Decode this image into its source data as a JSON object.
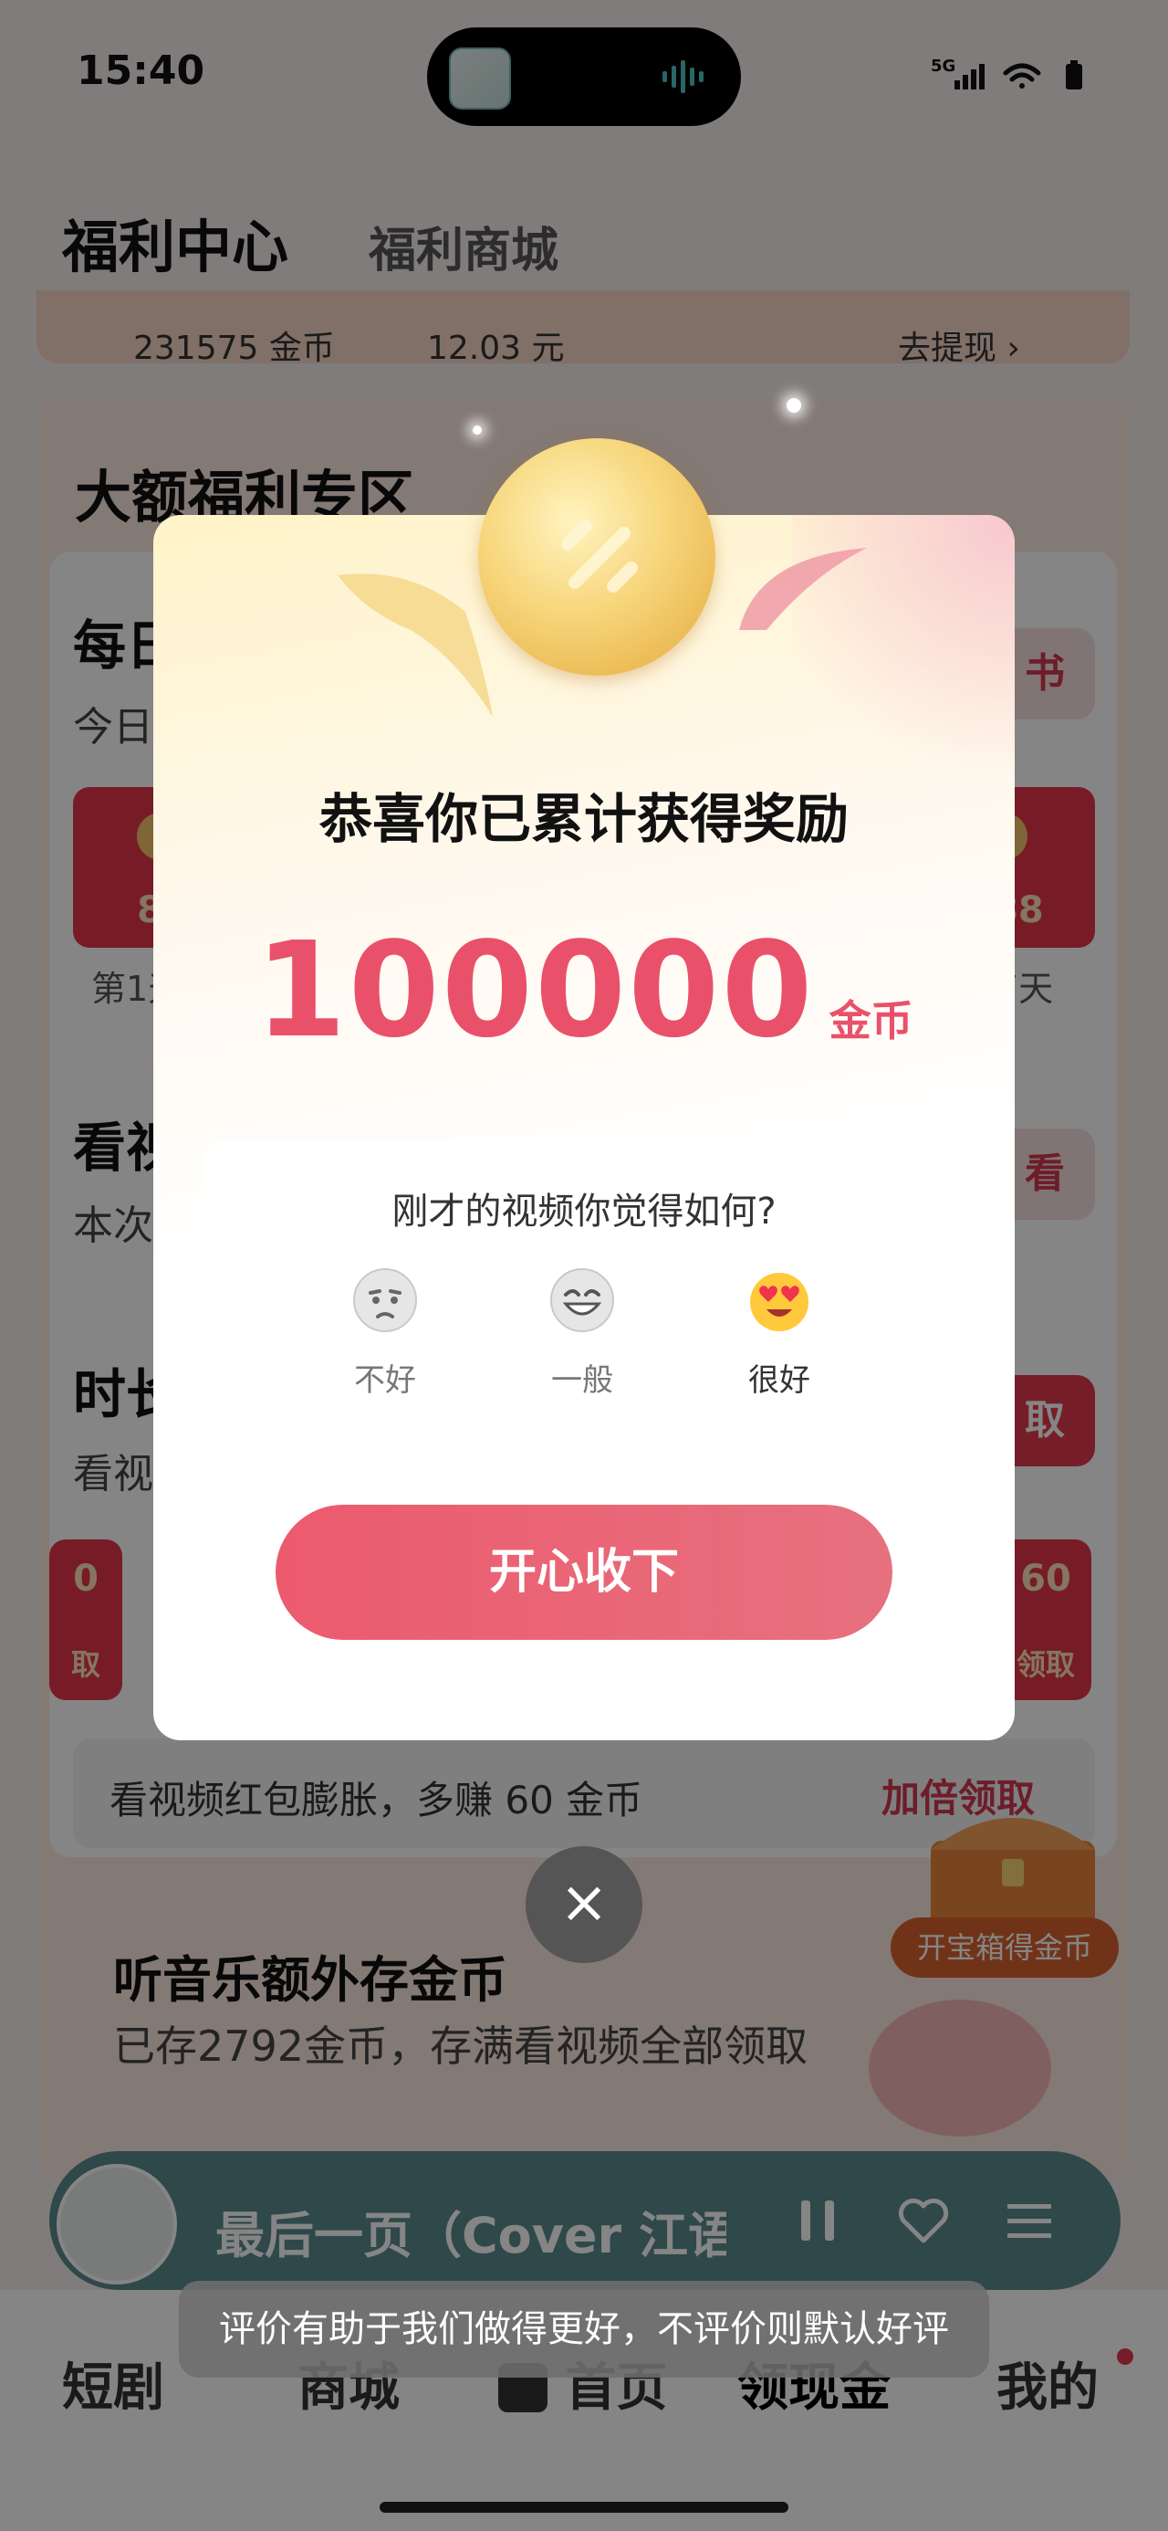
{
  "status_bar": {
    "time": "15:40",
    "network": "5G",
    "icons": [
      "signal-icon",
      "wifi-icon",
      "battery-icon"
    ]
  },
  "header": {
    "tabs": [
      {
        "label": "福利中心",
        "active": true
      },
      {
        "label": "福利商城",
        "active": false
      }
    ]
  },
  "earnings": {
    "coins": "231575 金币",
    "cash": "12.03 元",
    "withdraw": "去提现 ›"
  },
  "welfare_zone": {
    "title": "大额福利专区",
    "daily": {
      "title": "每日",
      "sub": "今日",
      "button": "书"
    },
    "envelopes": [
      {
        "value": "88",
        "day": "第1天"
      },
      {
        "value": "888",
        "day": "第7天"
      }
    ],
    "watch": {
      "title": "看视",
      "sub": "本次",
      "button": "看"
    },
    "timed": {
      "title": "时长",
      "sub": "看视",
      "button": "取"
    },
    "mini_envelopes": [
      {
        "value": "0",
        "label": "取"
      },
      {
        "value": "60",
        "label": "领取"
      }
    ],
    "strip": {
      "text": "看视频红包膨胀，多赚 60 金币",
      "link": "加倍领取"
    },
    "chest_button": "开宝箱得金币"
  },
  "music": {
    "title": "听音乐额外存金币",
    "sub": "已存2792金币，存满看视频全部领取"
  },
  "player": {
    "track": "最后一页（Cover 江语晨）"
  },
  "bottom_nav": [
    "短剧",
    "商城",
    "首页",
    "领现金",
    "我的"
  ],
  "modal": {
    "title": "恭喜你已累计获得奖励",
    "amount": "100000",
    "unit": "金币",
    "rating_question": "刚才的视频你觉得如何?",
    "ratings": [
      {
        "label": "不好"
      },
      {
        "label": "一般"
      },
      {
        "label": "很好"
      }
    ],
    "cta": "开心收下",
    "close": "×"
  },
  "toast": "评价有助于我们做得更好，不评价则默认好评",
  "colors": {
    "accent": "#e9516b",
    "cta_start": "#ec5a6e",
    "player": "#5b8b8c"
  }
}
